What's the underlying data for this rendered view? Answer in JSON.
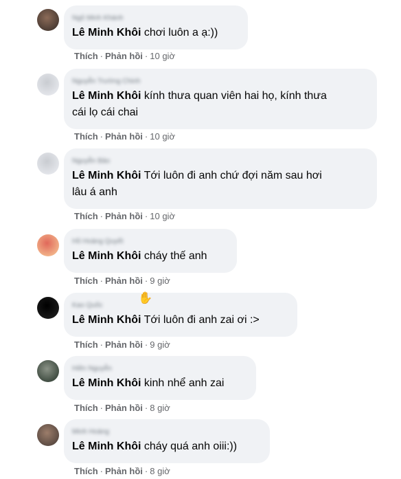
{
  "comments": [
    {
      "author": "Ngô Minh Khánh",
      "mention": "Lê Minh Khôi",
      "lines": [
        "chơi luôn a ạ:))"
      ],
      "like_label": "Thích",
      "reply_label": "Phản hồi",
      "time": "10 giờ",
      "avatar_colors": [
        "#4a3b33",
        "#8c6b58"
      ]
    },
    {
      "author": "Nguyễn Trường Chinh",
      "mention": "Lê Minh Khôi",
      "lines": [
        "kính thưa quan viên hai họ, kính thưa",
        "cái lọ cái chai"
      ],
      "like_label": "Thích",
      "reply_label": "Phản hồi",
      "time": "10 giờ",
      "avatar_colors": [
        "#e4e6eb",
        "#c9ccd1"
      ]
    },
    {
      "author": "Nguyễn Bảo",
      "mention": "Lê Minh Khôi",
      "lines": [
        "Tới luôn đi anh chứ đợi năm sau hơi",
        "lâu á anh"
      ],
      "like_label": "Thích",
      "reply_label": "Phản hồi",
      "time": "10 giờ",
      "avatar_colors": [
        "#e4e6eb",
        "#c9ccd1"
      ]
    },
    {
      "author": "Hồ Hoàng Quyết",
      "mention": "Lê Minh Khôi",
      "lines": [
        "cháy thế anh"
      ],
      "like_label": "Thích",
      "reply_label": "Phản hồi",
      "time": "9 giờ",
      "avatar_colors": [
        "#f2b48a",
        "#e0685a"
      ]
    },
    {
      "author": "Kao Quốc",
      "mention": "Lê Minh Khôi",
      "lines": [
        "Tới luôn đi anh zai ơi :>"
      ],
      "like_label": "Thích",
      "reply_label": "Phản hồi",
      "time": "9 giờ",
      "avatar_colors": [
        "#1a1a1a",
        "#000000"
      ],
      "badge_icon": "waving-hand-icon"
    },
    {
      "author": "Hiền Nguyễn",
      "mention": "Lê Minh Khôi",
      "lines": [
        "kinh nhể anh zai"
      ],
      "like_label": "Thích",
      "reply_label": "Phản hồi",
      "time": "8 giờ",
      "avatar_colors": [
        "#3d4a3f",
        "#8a9286"
      ]
    },
    {
      "author": "Minh Hoàng",
      "mention": "Lê Minh Khôi",
      "lines": [
        "cháy quá anh oiii:))"
      ],
      "like_label": "Thích",
      "reply_label": "Phản hồi",
      "time": "8 giờ",
      "avatar_colors": [
        "#5a4a42",
        "#9c7d6a"
      ]
    }
  ]
}
